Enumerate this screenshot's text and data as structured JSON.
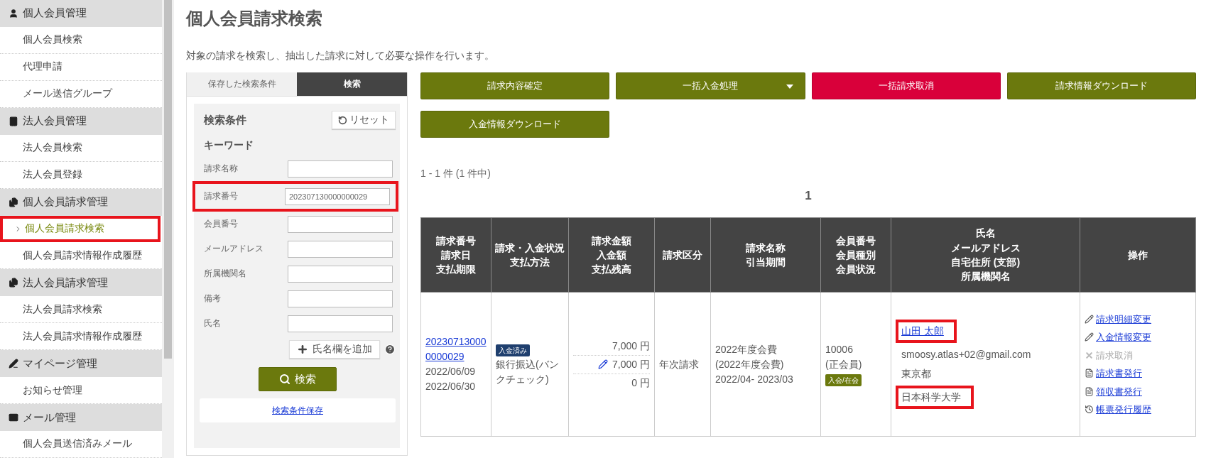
{
  "sidebar": {
    "sections": [
      {
        "title": "個人会員管理",
        "items": [
          {
            "label": "個人会員検索",
            "selected": false,
            "highlighted": false
          },
          {
            "label": "代理申請",
            "selected": false,
            "highlighted": false
          },
          {
            "label": "メール送信グループ",
            "selected": false,
            "highlighted": false
          }
        ]
      },
      {
        "title": "法人会員管理",
        "items": [
          {
            "label": "法人会員検索",
            "selected": false,
            "highlighted": false
          },
          {
            "label": "法人会員登録",
            "selected": false,
            "highlighted": false
          }
        ]
      },
      {
        "title": "個人会員請求管理",
        "items": [
          {
            "label": "個人会員請求検索",
            "selected": true,
            "highlighted": true
          },
          {
            "label": "個人会員請求情報作成履歴",
            "selected": false,
            "highlighted": false
          }
        ]
      },
      {
        "title": "法人会員請求管理",
        "items": [
          {
            "label": "法人会員請求検索",
            "selected": false,
            "highlighted": false
          },
          {
            "label": "法人会員請求情報作成履歴",
            "selected": false,
            "highlighted": false
          }
        ]
      },
      {
        "title": "マイページ管理",
        "items": [
          {
            "label": "お知らせ管理",
            "selected": false,
            "highlighted": false
          }
        ]
      },
      {
        "title": "メール管理",
        "items": [
          {
            "label": "個人会員送信済みメール",
            "selected": false,
            "highlighted": false
          }
        ]
      }
    ]
  },
  "page": {
    "title": "個人会員請求検索",
    "description": "対象の請求を検索し、抽出した請求に対して必要な操作を行います。"
  },
  "search_panel": {
    "tabs": [
      {
        "label": "保存した検索条件",
        "selected": false
      },
      {
        "label": "検索",
        "selected": true
      }
    ],
    "title": "検索条件",
    "reset_button": "リセット",
    "section": "キーワード",
    "fields": [
      {
        "label": "請求名称",
        "highlighted": false
      },
      {
        "label": "請求番号",
        "value": "202307130000000029",
        "highlighted": true
      },
      {
        "label": "会員番号",
        "highlighted": false
      },
      {
        "label": "メールアドレス",
        "highlighted": false
      },
      {
        "label": "所属機関名",
        "highlighted": false
      },
      {
        "label": "備考",
        "highlighted": false
      },
      {
        "label": "氏名",
        "highlighted": false
      }
    ],
    "add_name_button": "氏名欄を追加",
    "search_button": "検索",
    "save_link": "検索条件保存"
  },
  "actions": [
    {
      "label": "請求内容確定",
      "kind": "primary",
      "dropdown": false
    },
    {
      "label": "一括入金処理",
      "kind": "primary",
      "dropdown": true
    },
    {
      "label": "一括請求取消",
      "kind": "danger",
      "dropdown": false
    },
    {
      "label": "請求情報ダウンロード",
      "kind": "primary",
      "dropdown": false
    },
    {
      "label": "入金情報ダウンロード",
      "kind": "primary",
      "dropdown": false
    }
  ],
  "result_count": "1 - 1 件 (1 件中)",
  "pagination": [
    "1"
  ],
  "table": {
    "columns": [
      [
        "請求番号",
        "請求日",
        "支払期限"
      ],
      [
        "請求・入金状況",
        "支払方法"
      ],
      [
        "請求金額",
        "入金額",
        "支払残高"
      ],
      [
        "請求区分"
      ],
      [
        "請求名称",
        "引当期間"
      ],
      [
        "会員番号",
        "会員種別",
        "会員状況"
      ],
      [
        "氏名",
        "メールアドレス",
        "自宅住所 (支部)",
        "所属機関名"
      ],
      [
        "操作"
      ]
    ],
    "rows": [
      {
        "invoice_number": "202307130000000029",
        "invoice_date": "2022/06/09",
        "due_date": "2022/06/30",
        "status_badge": "入金済み",
        "payment_method": "銀行振込(バンクチェック)",
        "amounts": [
          {
            "text": "7,000 円",
            "edited": false
          },
          {
            "text": "7,000 円",
            "edited": true
          },
          {
            "text": "0 円",
            "edited": false
          }
        ],
        "category": "年次請求",
        "billing_name": [
          "2022年度会費",
          "(2022年度会費)",
          "2022/04- 2023/03"
        ],
        "member_number": "10006",
        "member_type": "(正会員)",
        "member_status": "入会/在会",
        "name": {
          "text": "山田 太郎",
          "highlighted": true
        },
        "email": "smoosy.atlas+02@gmail.com",
        "address": "東京都",
        "organization": {
          "text": "日本科学大学",
          "highlighted": true
        },
        "operations": [
          {
            "label": "請求明細変更",
            "kind": "edit",
            "disabled": false
          },
          {
            "label": "入金情報変更",
            "kind": "edit",
            "disabled": false
          },
          {
            "label": "請求取消",
            "kind": "cancel",
            "disabled": true
          },
          {
            "label": "請求書発行",
            "kind": "document",
            "disabled": false
          },
          {
            "label": "領収書発行",
            "kind": "document",
            "disabled": false
          },
          {
            "label": "帳票発行履歴",
            "kind": "history",
            "disabled": false
          }
        ]
      }
    ]
  }
}
